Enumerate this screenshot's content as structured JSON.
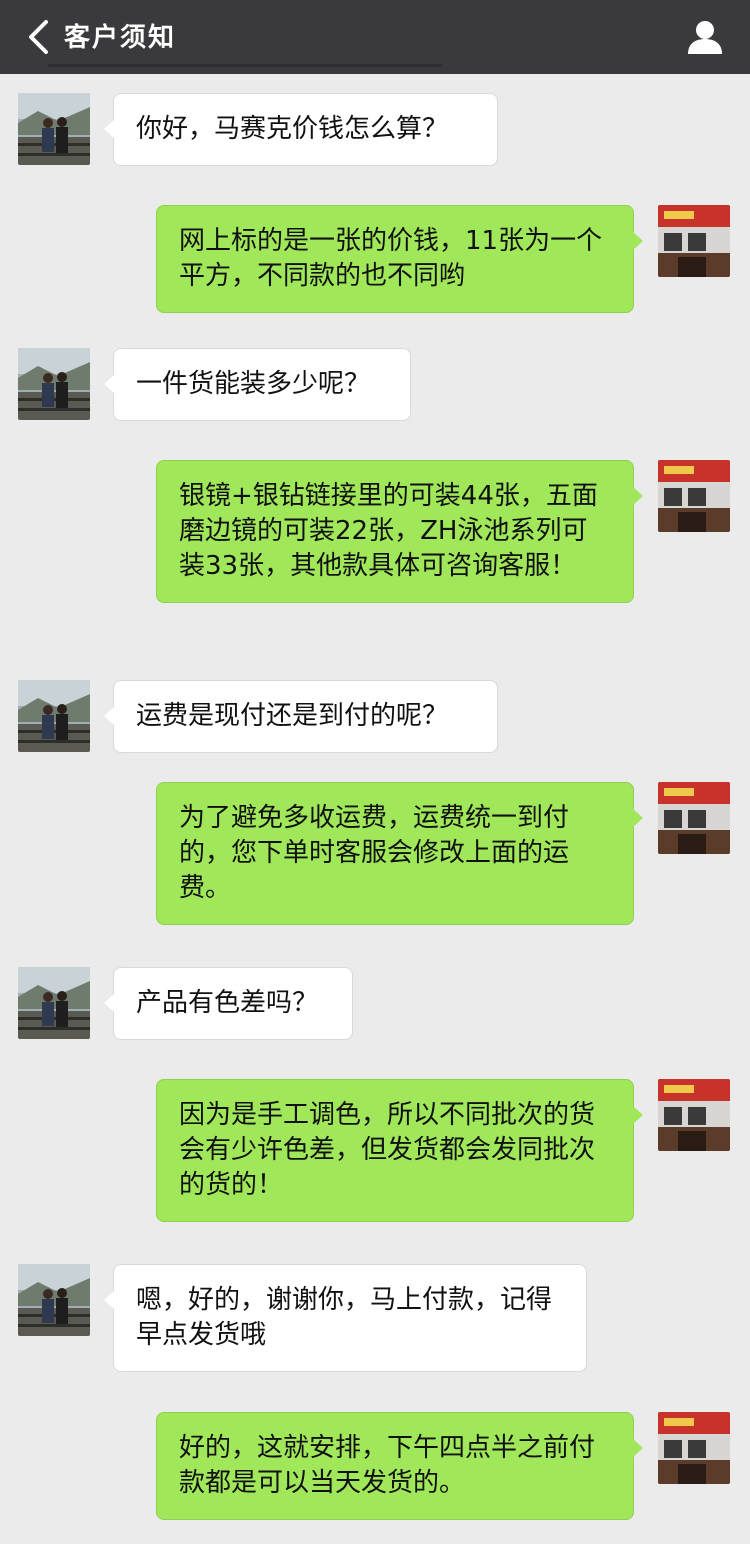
{
  "header": {
    "title": "客户须知"
  },
  "colors": {
    "header_bg": "#3a3a3d",
    "page_bg": "#ebebeb",
    "outgoing_bubble": "#a0e75a",
    "incoming_bubble": "#ffffff"
  },
  "messages": [
    {
      "side": "left",
      "text": "你好，马赛克价钱怎么算？"
    },
    {
      "side": "right",
      "text": "网上标的是一张的价钱，11张为一个平方，不同款的也不同哟"
    },
    {
      "side": "left",
      "text": "一件货能装多少呢？"
    },
    {
      "side": "right",
      "text": "银镜+银钻链接里的可装44张，五面磨边镜的可装22张，ZH泳池系列可装33张，其他款具体可咨询客服！"
    },
    {
      "side": "left",
      "text": "运费是现付还是到付的呢？"
    },
    {
      "side": "right",
      "text": "为了避免多收运费，运费统一到付的，您下单时客服会修改上面的运费。"
    },
    {
      "side": "left",
      "text": "产品有色差吗？"
    },
    {
      "side": "right",
      "text": "因为是手工调色，所以不同批次的货会有少许色差，但发货都会发同批次的货的！"
    },
    {
      "side": "left",
      "text": "嗯，好的，谢谢你，马上付款，记得早点发货哦"
    },
    {
      "side": "right",
      "text": "好的，这就安排，下午四点半之前付款都是可以当天发货的。"
    }
  ]
}
